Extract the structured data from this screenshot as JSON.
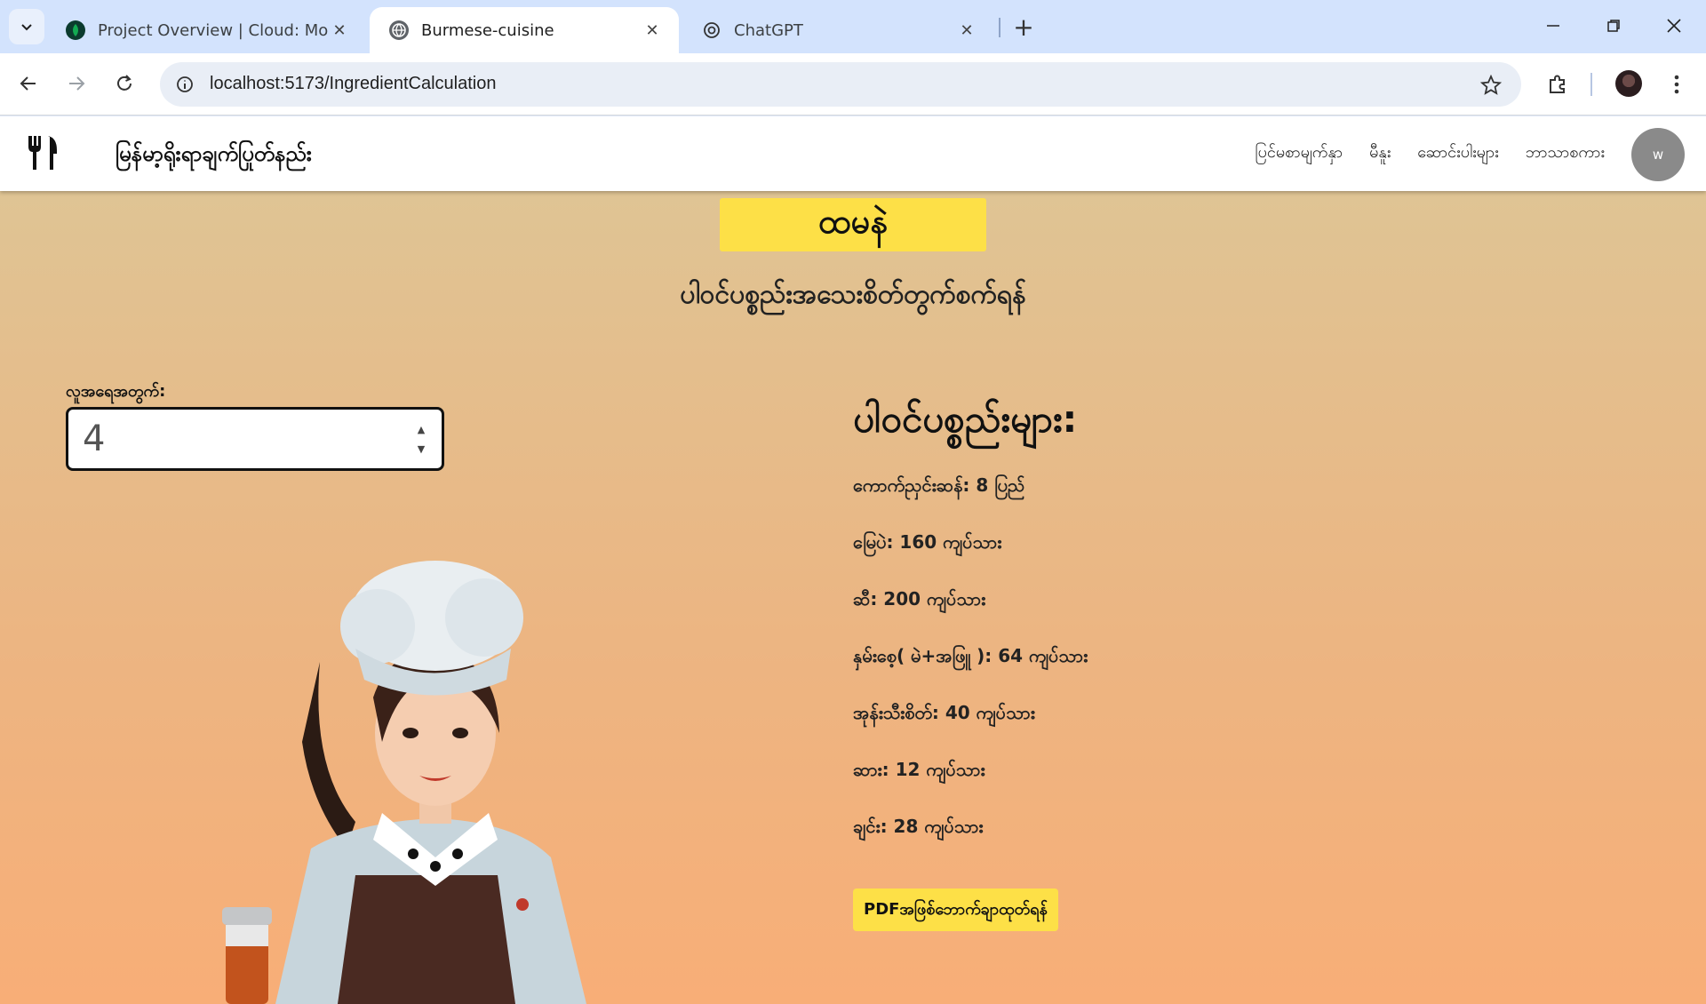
{
  "browser": {
    "tabs": [
      {
        "title": "Project Overview | Cloud: Mong",
        "favicon": "mongodb-leaf-icon",
        "active": false
      },
      {
        "title": "Burmese-cuisine",
        "favicon": "globe-icon",
        "active": true
      },
      {
        "title": "ChatGPT",
        "favicon": "chatgpt-icon",
        "active": false
      }
    ],
    "url": "localhost:5173/IngredientCalculation",
    "colors": {
      "tabstrip": "#d3e3fd",
      "omnibox": "#e9eef6"
    }
  },
  "app": {
    "brand_icon": "fork-knife-icon",
    "brand_title": "မြန်မာ့ရိုးရာချက်ပြုတ်နည်း",
    "menu": [
      "ပြင်မစာမျက်နှာ",
      "မီနူး",
      "ဆောင်းပါးများ",
      "ဘာသာစကား"
    ],
    "user_initial": "w"
  },
  "page": {
    "dish_name": "ထမနဲ",
    "subtitle": "ပါဝင်ပစ္စည်းအသေးစိတ်တွက်စက်ရန်",
    "people_label": "လူအရေအတွက်:",
    "people_count": "4",
    "ingredients_title": "ပါဝင်ပစ္စည်းများ:",
    "ingredients": [
      "ကောက်ညှင်းဆန်: 8 ပြည်",
      "မြေပဲ: 160 ကျပ်သား",
      "ဆီ: 200 ကျပ်သား",
      "နှမ်းစေ့( မဲ+အဖြူ ): 64 ကျပ်သား",
      "အုန်းသီးစိတ်: 40 ကျပ်သား",
      "ဆား: 12 ကျပ်သား",
      "ချင်း: 28 ကျပ်သား"
    ],
    "pdf_button": "PDFအဖြစ်ဘောက်ချာထုတ်ရန်",
    "accent_color": "#fde047"
  }
}
